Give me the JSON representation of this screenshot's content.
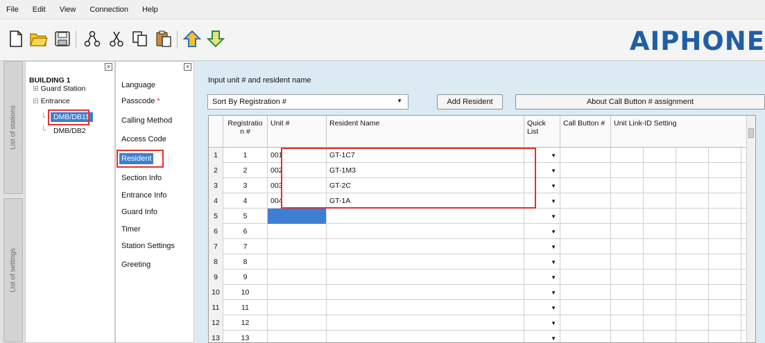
{
  "menu": [
    "File",
    "Edit",
    "View",
    "Connection",
    "Help"
  ],
  "logo": "AIPHONE",
  "side_tabs": {
    "stations": "List of stations",
    "settings": "List of settings"
  },
  "tree": {
    "building": "BUILDING 1",
    "guard_station": "Guard Station",
    "entrance": "Entrance",
    "stations": [
      "DMB/DB1$",
      "DMB/DB2"
    ]
  },
  "settings": [
    "Language",
    "Passcode",
    "Calling Method",
    "Access Code",
    "Resident",
    "Section Info",
    "Entrance Info",
    "Guard Info",
    "Timer",
    "Station Settings",
    "Greeting"
  ],
  "passcode_marker": "*",
  "main": {
    "label": "Input unit # and resident name",
    "sort_value": "Sort By Registration #",
    "add_button": "Add Resident",
    "about_button": "About Call Button # assignment"
  },
  "table": {
    "headers": {
      "registration": "Registratio n #",
      "unit": "Unit #",
      "name": "Resident Name",
      "quick": "Quick List",
      "call": "Call Button #",
      "link": "Unit Link-ID Setting"
    },
    "rows": [
      {
        "n": "1",
        "reg": "1",
        "unit": "001",
        "name": "GT-1C7"
      },
      {
        "n": "2",
        "reg": "2",
        "unit": "002",
        "name": "GT-1M3"
      },
      {
        "n": "3",
        "reg": "3",
        "unit": "003",
        "name": "GT-2C"
      },
      {
        "n": "4",
        "reg": "4",
        "unit": "004",
        "name": "GT-1A"
      },
      {
        "n": "5",
        "reg": "5",
        "unit": "",
        "name": ""
      },
      {
        "n": "6",
        "reg": "6",
        "unit": "",
        "name": ""
      },
      {
        "n": "7",
        "reg": "7",
        "unit": "",
        "name": ""
      },
      {
        "n": "8",
        "reg": "8",
        "unit": "",
        "name": ""
      },
      {
        "n": "9",
        "reg": "9",
        "unit": "",
        "name": ""
      },
      {
        "n": "10",
        "reg": "10",
        "unit": "",
        "name": ""
      },
      {
        "n": "11",
        "reg": "11",
        "unit": "",
        "name": ""
      },
      {
        "n": "12",
        "reg": "12",
        "unit": "",
        "name": ""
      },
      {
        "n": "13",
        "reg": "13",
        "unit": "",
        "name": ""
      }
    ]
  },
  "colors": {
    "highlight": "#e0302d",
    "selection": "#3d7fd0",
    "logo": "#1f5fa5",
    "panel": "#dcebf3"
  }
}
